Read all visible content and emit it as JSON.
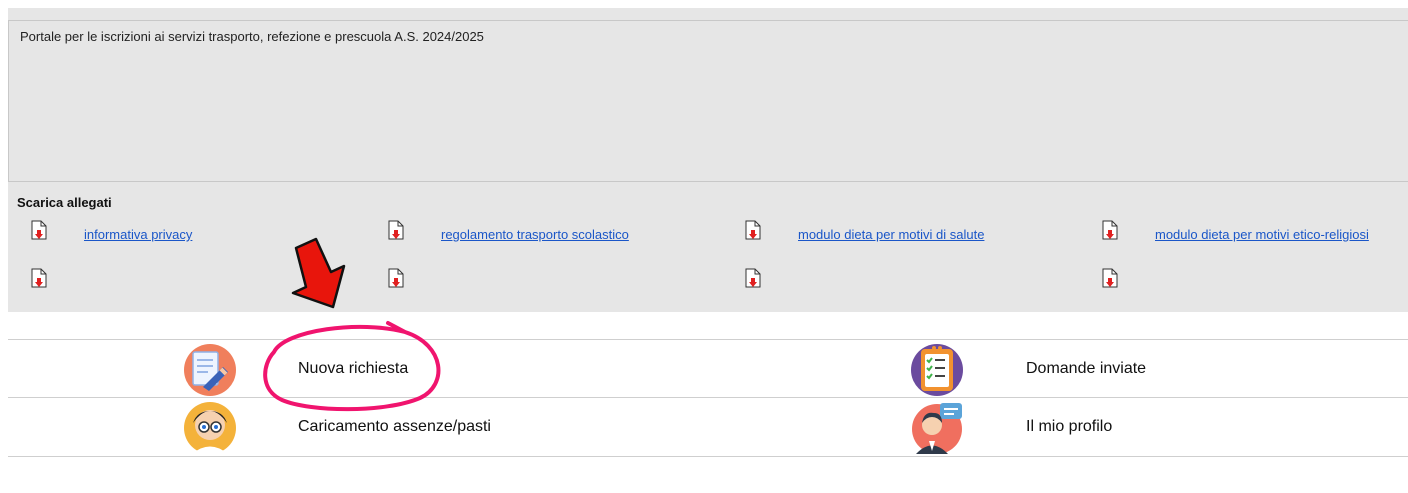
{
  "portal": {
    "description": "Portale per le iscrizioni ai servizi trasporto, refezione e prescuola A.S. 2024/2025"
  },
  "attachments": {
    "title": "Scarica allegati",
    "items": [
      {
        "label": "informativa privacy",
        "icon": "pdf-download-icon"
      },
      {
        "label": "regolamento trasporto scolastico",
        "icon": "pdf-download-icon"
      },
      {
        "label": "modulo dieta per motivi di salute",
        "icon": "pdf-download-icon"
      },
      {
        "label": "modulo dieta per motivi etico-religiosi",
        "icon": "pdf-download-icon"
      },
      {
        "label": "",
        "icon": "pdf-download-icon"
      },
      {
        "label": "",
        "icon": "pdf-download-icon"
      },
      {
        "label": "",
        "icon": "pdf-download-icon"
      },
      {
        "label": "",
        "icon": "pdf-download-icon"
      }
    ]
  },
  "menu": {
    "new_request": "Nuova richiesta",
    "sent_applications": "Domande inviate",
    "absences_meals": "Caricamento assenze/pasti",
    "my_profile": "Il mio profilo"
  },
  "colors": {
    "link": "#1a56c8",
    "annotation_arrow": "#e8150c",
    "annotation_circle": "#f0146e"
  }
}
